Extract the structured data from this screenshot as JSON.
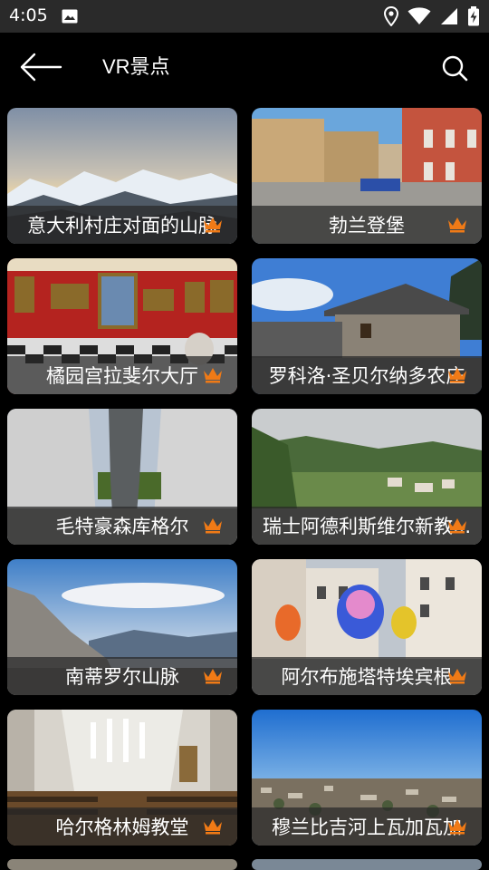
{
  "status_bar": {
    "time": "4:05",
    "icons": [
      "image-icon",
      "location-icon",
      "wifi-icon",
      "signal-icon",
      "battery-charging-icon"
    ]
  },
  "app_bar": {
    "title": "VR景点",
    "back_icon": "arrow-left-icon",
    "search_icon": "search-icon"
  },
  "colors": {
    "background": "#000000",
    "status_bar": "#2a2a2a",
    "crown": "#f07a16",
    "caption_overlay": "rgba(40,40,40,0.72)"
  },
  "attractions": [
    {
      "name": "意大利村庄对面的山脉",
      "premium_icon": "crown-icon"
    },
    {
      "name": "勃兰登堡",
      "premium_icon": "crown-icon"
    },
    {
      "name": "橘园宫拉斐尔大厅",
      "premium_icon": "crown-icon"
    },
    {
      "name": "罗科洛·圣贝尔纳多农庄",
      "premium_icon": "crown-icon"
    },
    {
      "name": "毛特豪森库格尔",
      "premium_icon": "crown-icon"
    },
    {
      "name": "瑞士阿德利斯维尔新教...",
      "premium_icon": "crown-icon"
    },
    {
      "name": "南蒂罗尔山脉",
      "premium_icon": "crown-icon"
    },
    {
      "name": "阿尔布施塔特埃宾根",
      "premium_icon": "crown-icon"
    },
    {
      "name": "哈尔格林姆教堂",
      "premium_icon": "crown-icon"
    },
    {
      "name": "穆兰比吉河上瓦加瓦加",
      "premium_icon": "crown-icon"
    }
  ]
}
